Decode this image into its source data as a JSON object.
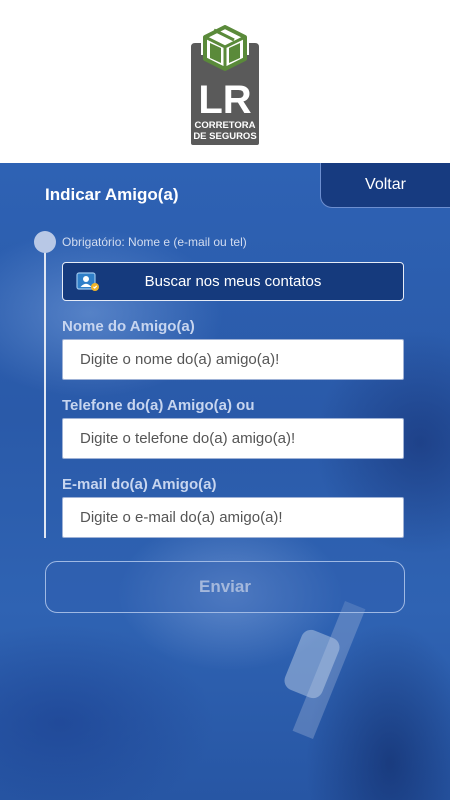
{
  "brand": {
    "logo_letters": "LR",
    "logo_line1": "CORRETORA",
    "logo_line2": "DE SEGUROS"
  },
  "nav": {
    "back_label": "Voltar"
  },
  "page": {
    "title": "Indicar Amigo(a)",
    "required_note": "Obrigatório: Nome e (e-mail ou tel)"
  },
  "contacts_button": {
    "label": "Buscar nos meus contatos",
    "icon": "contacts-icon"
  },
  "form": {
    "name": {
      "label": "Nome do Amigo(a)",
      "placeholder": "Digite o nome do(a) amigo(a)!",
      "value": ""
    },
    "phone": {
      "label": "Telefone do(a) Amigo(a) ou",
      "placeholder": "Digite o telefone do(a) amigo(a)!",
      "value": ""
    },
    "email": {
      "label": "E-mail do(a) Amigo(a)",
      "placeholder": "Digite o e-mail do(a) amigo(a)!",
      "value": ""
    }
  },
  "submit": {
    "label": "Enviar"
  },
  "colors": {
    "header_bg": "#ffffff",
    "logo_gray": "#5a5a5a",
    "logo_green": "#5a8a3a",
    "dark_blue": "#173b80",
    "background_blue": "#2a5aa6"
  }
}
